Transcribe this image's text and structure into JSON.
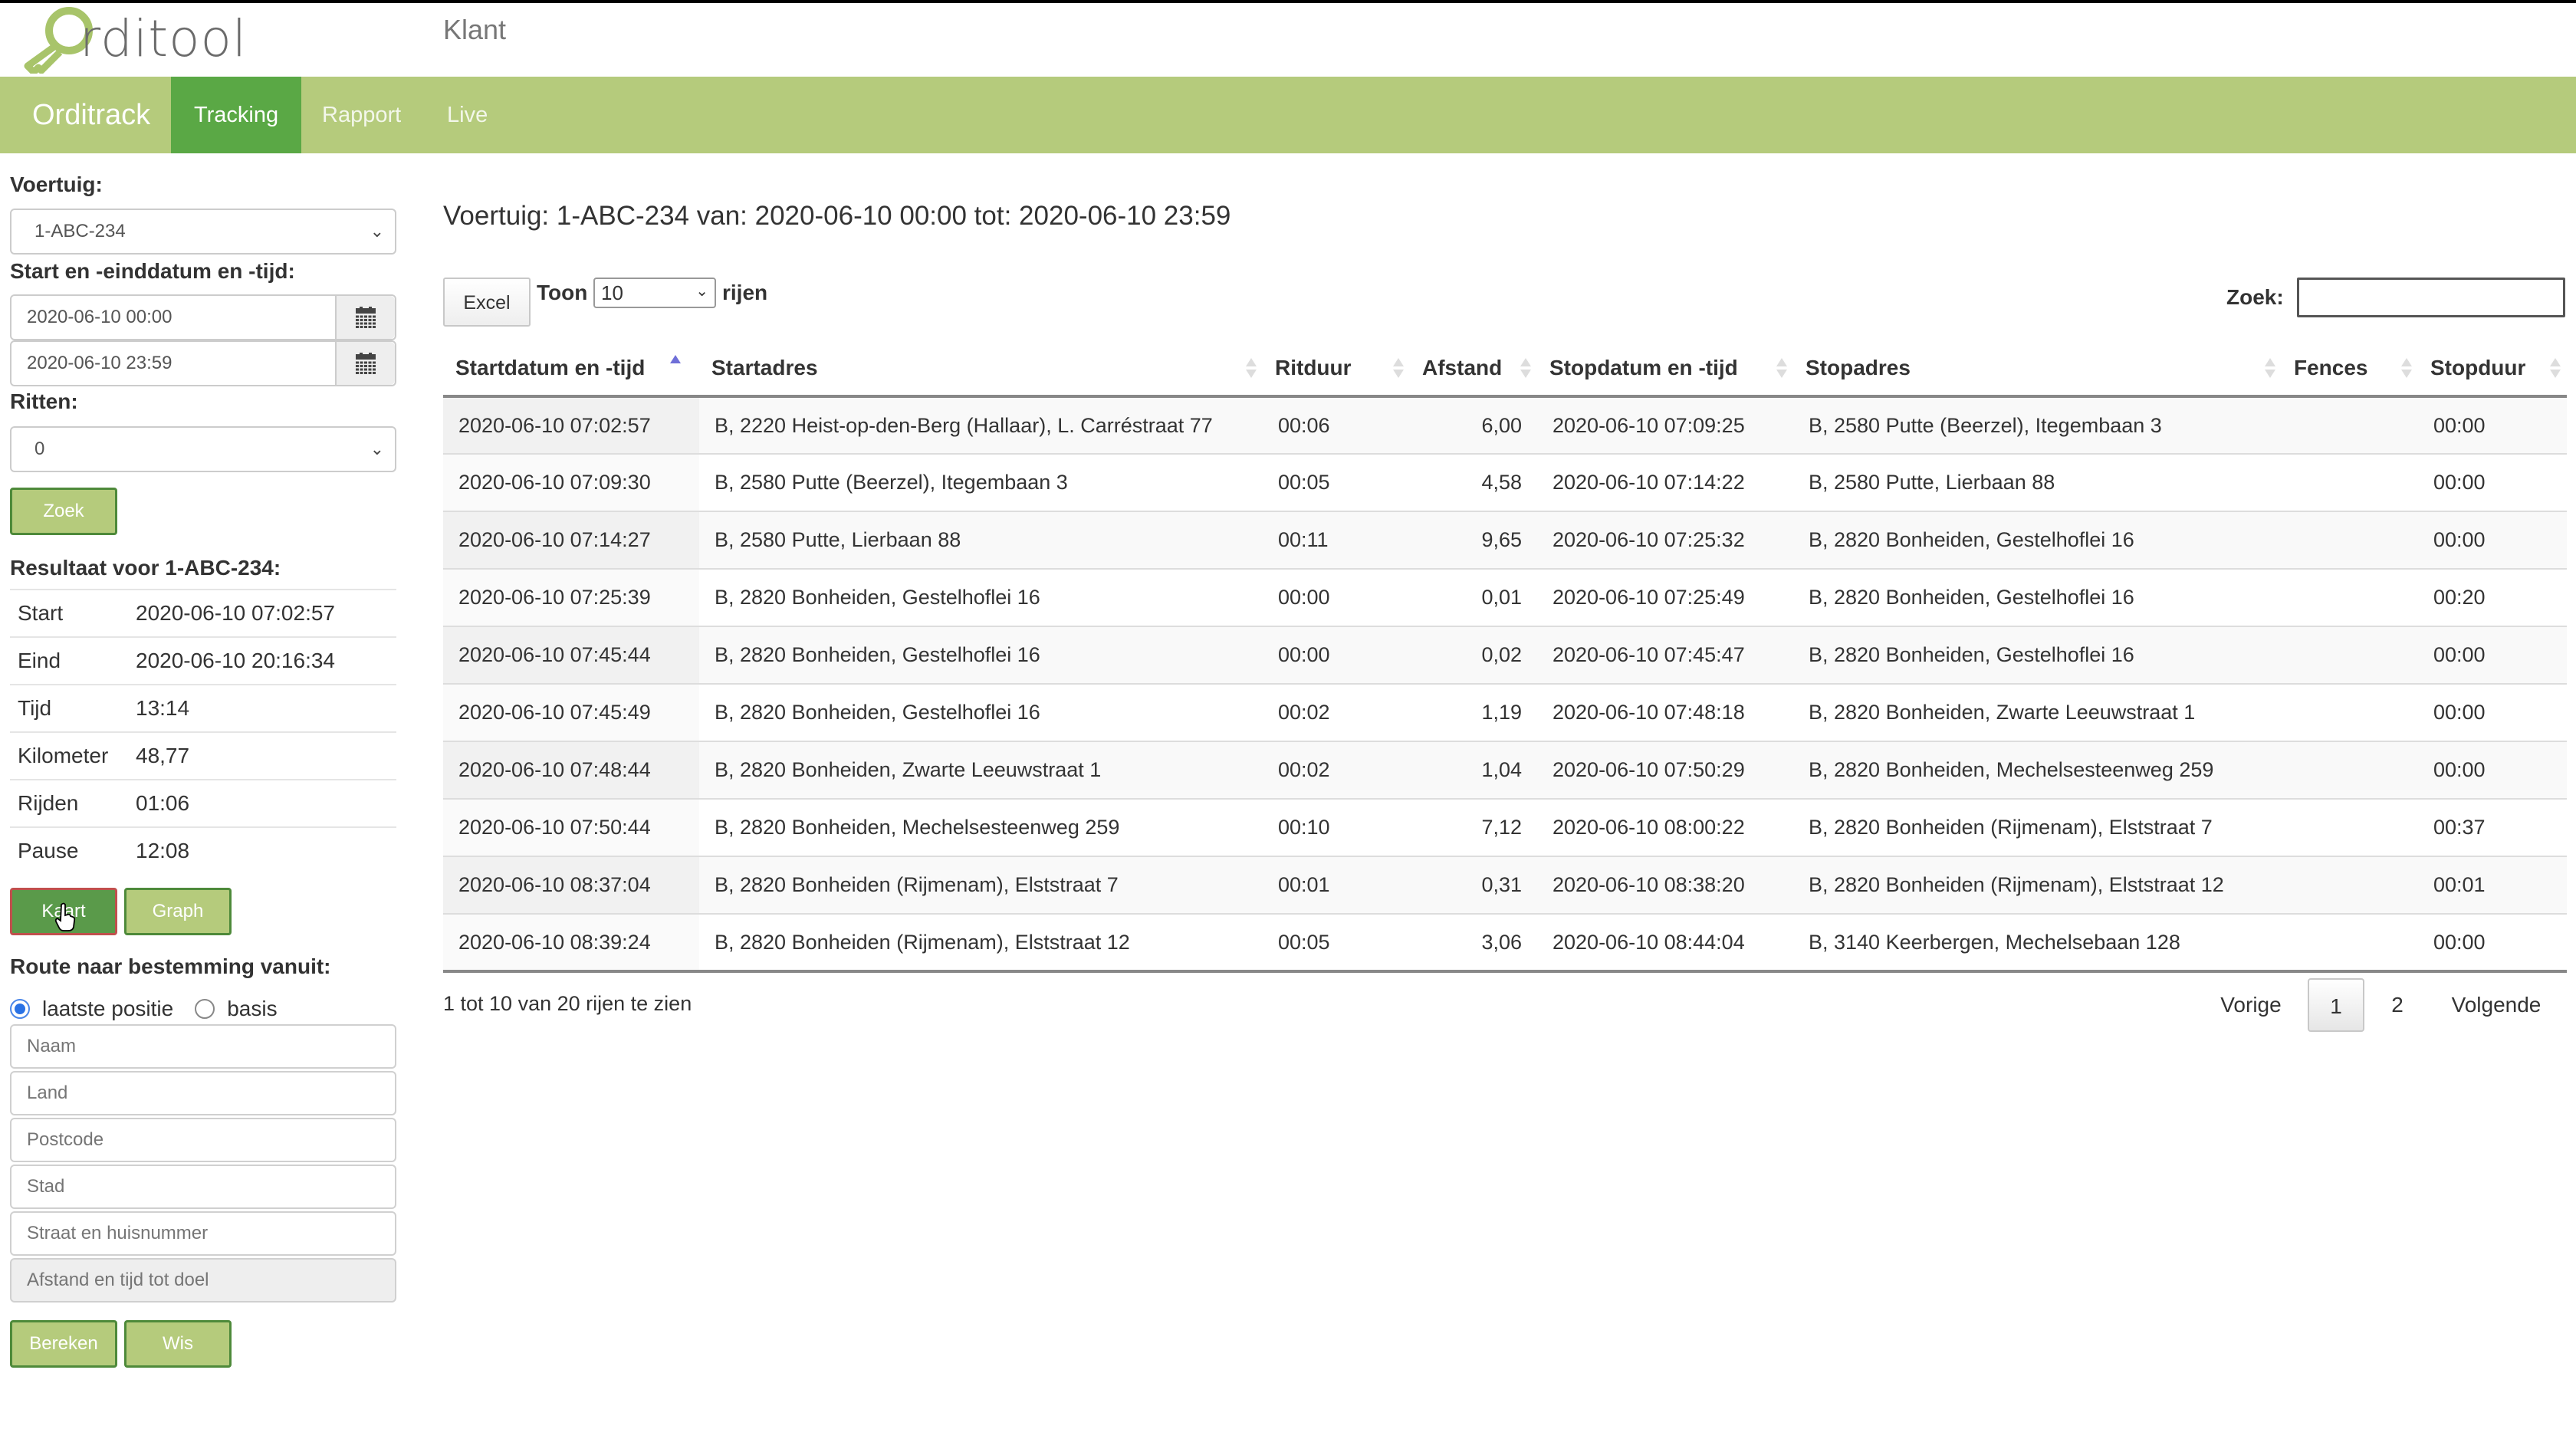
{
  "header": {
    "logo_text": "rditool",
    "client_title": "Klant"
  },
  "nav": {
    "brand": "Orditrack",
    "items": [
      {
        "label": "Tracking",
        "active": true
      },
      {
        "label": "Rapport",
        "active": false
      },
      {
        "label": "Live",
        "active": false
      }
    ]
  },
  "colors": {
    "nav_bg": "#b5cb7c",
    "nav_active": "#5aa845",
    "button_green": "#b5cb7c",
    "button_border": "#4e8a3a",
    "sort_active": "#6f6fd8"
  },
  "sidebar": {
    "vehicle_label": "Voertuig:",
    "vehicle_value": "1-ABC-234",
    "daterange_label": "Start en -einddatum en -tijd:",
    "start_value": "2020-06-10 00:00",
    "end_value": "2020-06-10 23:59",
    "trips_label": "Ritten:",
    "trips_value": "0",
    "search_button": "Zoek",
    "result_title": "Resultaat voor 1-ABC-234:",
    "stats": [
      {
        "key": "Start",
        "value": "2020-06-10 07:02:57"
      },
      {
        "key": "Eind",
        "value": "2020-06-10 20:16:34"
      },
      {
        "key": "Tijd",
        "value": "13:14"
      },
      {
        "key": "Kilometer",
        "value": "48,77"
      },
      {
        "key": "Rijden",
        "value": "01:06"
      },
      {
        "key": "Pause",
        "value": "12:08"
      }
    ],
    "map_button": "Kaart",
    "graph_button": "Graph",
    "route_label": "Route naar bestemming vanuit:",
    "radio_options": [
      {
        "label": "laatste positie",
        "checked": true
      },
      {
        "label": "basis",
        "checked": false
      }
    ],
    "inputs": [
      {
        "placeholder": "Naam",
        "value": ""
      },
      {
        "placeholder": "Land",
        "value": ""
      },
      {
        "placeholder": "Postcode",
        "value": ""
      },
      {
        "placeholder": "Stad",
        "value": ""
      },
      {
        "placeholder": "Straat en huisnummer",
        "value": ""
      },
      {
        "placeholder": "Afstand en tijd tot doel",
        "value": "",
        "disabled": true
      }
    ],
    "calculate_button": "Bereken",
    "clear_button": "Wis"
  },
  "main": {
    "title": "Voertuig: 1-ABC-234 van: 2020-06-10 00:00 tot: 2020-06-10 23:59",
    "excel_button": "Excel",
    "show_label": "Toon",
    "page_length": "10",
    "rows_label": "rijen",
    "search_label": "Zoek:",
    "search_value": "",
    "columns": [
      {
        "label": "Startdatum en -tijd",
        "sort": "asc"
      },
      {
        "label": "Startadres",
        "sort": "none"
      },
      {
        "label": "Ritduur",
        "sort": "none"
      },
      {
        "label": "Afstand",
        "sort": "none"
      },
      {
        "label": "Stopdatum en -tijd",
        "sort": "none"
      },
      {
        "label": "Stopadres",
        "sort": "none"
      },
      {
        "label": "Fences",
        "sort": "none"
      },
      {
        "label": "Stopduur",
        "sort": "none"
      }
    ],
    "rows": [
      [
        "2020-06-10 07:02:57",
        "B, 2220 Heist-op-den-Berg (Hallaar), L. Carréstraat 77",
        "00:06",
        "6,00",
        "2020-06-10 07:09:25",
        "B, 2580 Putte (Beerzel), Itegembaan 3",
        "",
        "00:00"
      ],
      [
        "2020-06-10 07:09:30",
        "B, 2580 Putte (Beerzel), Itegembaan 3",
        "00:05",
        "4,58",
        "2020-06-10 07:14:22",
        "B, 2580 Putte, Lierbaan 88",
        "",
        "00:00"
      ],
      [
        "2020-06-10 07:14:27",
        "B, 2580 Putte, Lierbaan 88",
        "00:11",
        "9,65",
        "2020-06-10 07:25:32",
        "B, 2820 Bonheiden, Gestelhoflei 16",
        "",
        "00:00"
      ],
      [
        "2020-06-10 07:25:39",
        "B, 2820 Bonheiden, Gestelhoflei 16",
        "00:00",
        "0,01",
        "2020-06-10 07:25:49",
        "B, 2820 Bonheiden, Gestelhoflei 16",
        "",
        "00:20"
      ],
      [
        "2020-06-10 07:45:44",
        "B, 2820 Bonheiden, Gestelhoflei 16",
        "00:00",
        "0,02",
        "2020-06-10 07:45:47",
        "B, 2820 Bonheiden, Gestelhoflei 16",
        "",
        "00:00"
      ],
      [
        "2020-06-10 07:45:49",
        "B, 2820 Bonheiden, Gestelhoflei 16",
        "00:02",
        "1,19",
        "2020-06-10 07:48:18",
        "B, 2820 Bonheiden, Zwarte Leeuwstraat 1",
        "",
        "00:00"
      ],
      [
        "2020-06-10 07:48:44",
        "B, 2820 Bonheiden, Zwarte Leeuwstraat 1",
        "00:02",
        "1,04",
        "2020-06-10 07:50:29",
        "B, 2820 Bonheiden, Mechelsesteenweg 259",
        "",
        "00:00"
      ],
      [
        "2020-06-10 07:50:44",
        "B, 2820 Bonheiden, Mechelsesteenweg 259",
        "00:10",
        "7,12",
        "2020-06-10 08:00:22",
        "B, 2820 Bonheiden (Rijmenam), Elststraat 7",
        "",
        "00:37"
      ],
      [
        "2020-06-10 08:37:04",
        "B, 2820 Bonheiden (Rijmenam), Elststraat 7",
        "00:01",
        "0,31",
        "2020-06-10 08:38:20",
        "B, 2820 Bonheiden (Rijmenam), Elststraat 12",
        "",
        "00:01"
      ],
      [
        "2020-06-10 08:39:24",
        "B, 2820 Bonheiden (Rijmenam), Elststraat 12",
        "00:05",
        "3,06",
        "2020-06-10 08:44:04",
        "B, 3140 Keerbergen, Mechelsebaan 128",
        "",
        "00:00"
      ]
    ],
    "info_text": "1 tot 10 van 20 rijen te zien",
    "pagination": {
      "previous": "Vorige",
      "pages": [
        "1",
        "2"
      ],
      "current_page": "1",
      "next": "Volgende"
    }
  }
}
